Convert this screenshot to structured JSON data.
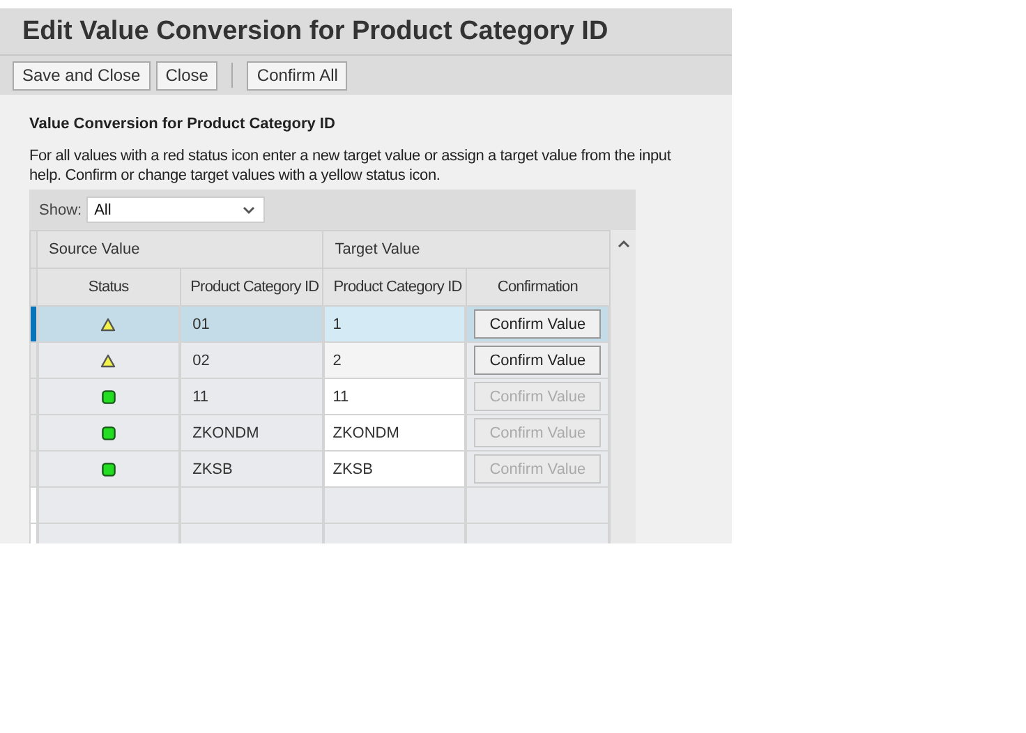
{
  "window": {
    "title": "Edit Value Conversion for Product Category ID"
  },
  "toolbar": [
    {
      "label": "Save and Close",
      "kind": "button"
    },
    {
      "label": "Close",
      "kind": "button"
    },
    {
      "kind": "separator"
    },
    {
      "label": "Confirm All",
      "kind": "button"
    }
  ],
  "section": {
    "title": "Value Conversion for Product Category ID",
    "description": "For all values with a red status icon enter a new target value or assign a target value from the input help. Confirm or change target values with a yellow status icon."
  },
  "filter": {
    "label": "Show:",
    "value": "All"
  },
  "table": {
    "column_groups": [
      "Source Value",
      "Target Value"
    ],
    "columns": [
      "Status",
      "Product Category ID",
      "Product Category ID",
      "Confirmation"
    ],
    "rows": [
      {
        "kind": "warning",
        "source": "01",
        "target": "1",
        "confirm": "Confirm Value",
        "disabled": false,
        "selected": true
      },
      {
        "kind": "warning",
        "source": "02",
        "target": "2",
        "confirm": "Confirm Value",
        "disabled": false,
        "selected": false
      },
      {
        "kind": "ok",
        "source": "11",
        "target": "11",
        "confirm": "Confirm Value",
        "disabled": true,
        "selected": false
      },
      {
        "kind": "ok",
        "source": "ZKONDM",
        "target": "ZKONDM",
        "confirm": "Confirm Value",
        "disabled": true,
        "selected": false
      },
      {
        "kind": "ok",
        "source": "ZKSB",
        "target": "ZKSB",
        "confirm": "Confirm Value",
        "disabled": true,
        "selected": false
      }
    ]
  }
}
